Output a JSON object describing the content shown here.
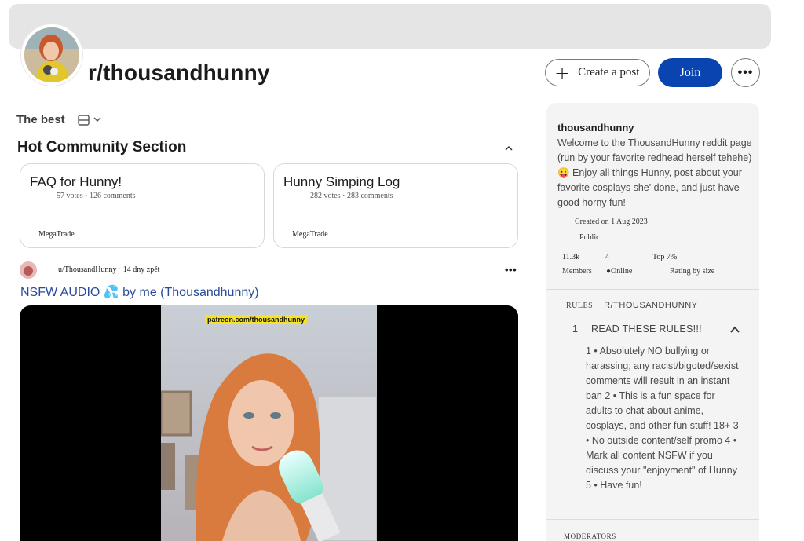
{
  "header": {
    "subreddit": "r/thousandhunny",
    "create_post_label": "Create a post",
    "join_label": "Join",
    "more_label": "•••"
  },
  "feed": {
    "sort_label": "The best",
    "hot_section_title": "Hot Community Section",
    "hot_cards": [
      {
        "title": "FAQ for Hunny!",
        "meta": "57 votes · 126 comments",
        "author": "MegaTrade"
      },
      {
        "title": "Hunny Simping Log",
        "meta": "282 votes · 283 comments",
        "author": "MegaTrade"
      }
    ],
    "post": {
      "meta": "u/ThousandHunny · 14 dny zpět",
      "title": "NSFW AUDIO 💦 by me (Thousandhunny)",
      "media_caption": "patreon.com/thousandhunny"
    }
  },
  "sidebar": {
    "name": "thousandhunny",
    "description": "Welcome to the ThousandHunny reddit page (run by your favorite redhead herself tehehe) 😛 Enjoy all things Hunny, post about your favorite cosplays she' done, and just have good horny fun!",
    "created": "Created on 1 Aug 2023",
    "visibility": "Public",
    "stats": [
      {
        "value": "11.3k",
        "label": "Members"
      },
      {
        "value": "4",
        "label": "●Online"
      },
      {
        "value": "Top 7%",
        "label": "Rating by size"
      }
    ],
    "rules_label": "RULES",
    "rules_subreddit": "R/THOUSANDHUNNY",
    "rule": {
      "number": "1",
      "title": "READ THESE RULES!!!",
      "body": "1 • Absolutely NO bullying or harassing; any racist/bigoted/sexist comments will result in an instant ban 2 • This is a fun space for adults to chat about anime, cosplays, and other fun stuff! 18+ 3 • No outside content/self promo 4 • Mark all content NSFW if you discuss your \"enjoyment\" of Hunny 5 • Have fun!"
    },
    "moderators_label": "MODERATORS"
  },
  "colors": {
    "join_button": "#0a44b0",
    "banner": "#e5e5e5",
    "sidebar_bg": "#f4f4f4",
    "post_title": "#2a4a9c",
    "caption_bg": "#f5e32a"
  },
  "icons": [
    "plus-icon",
    "layout-icon",
    "chevron-down-icon",
    "chevron-up-icon",
    "more-icon"
  ]
}
